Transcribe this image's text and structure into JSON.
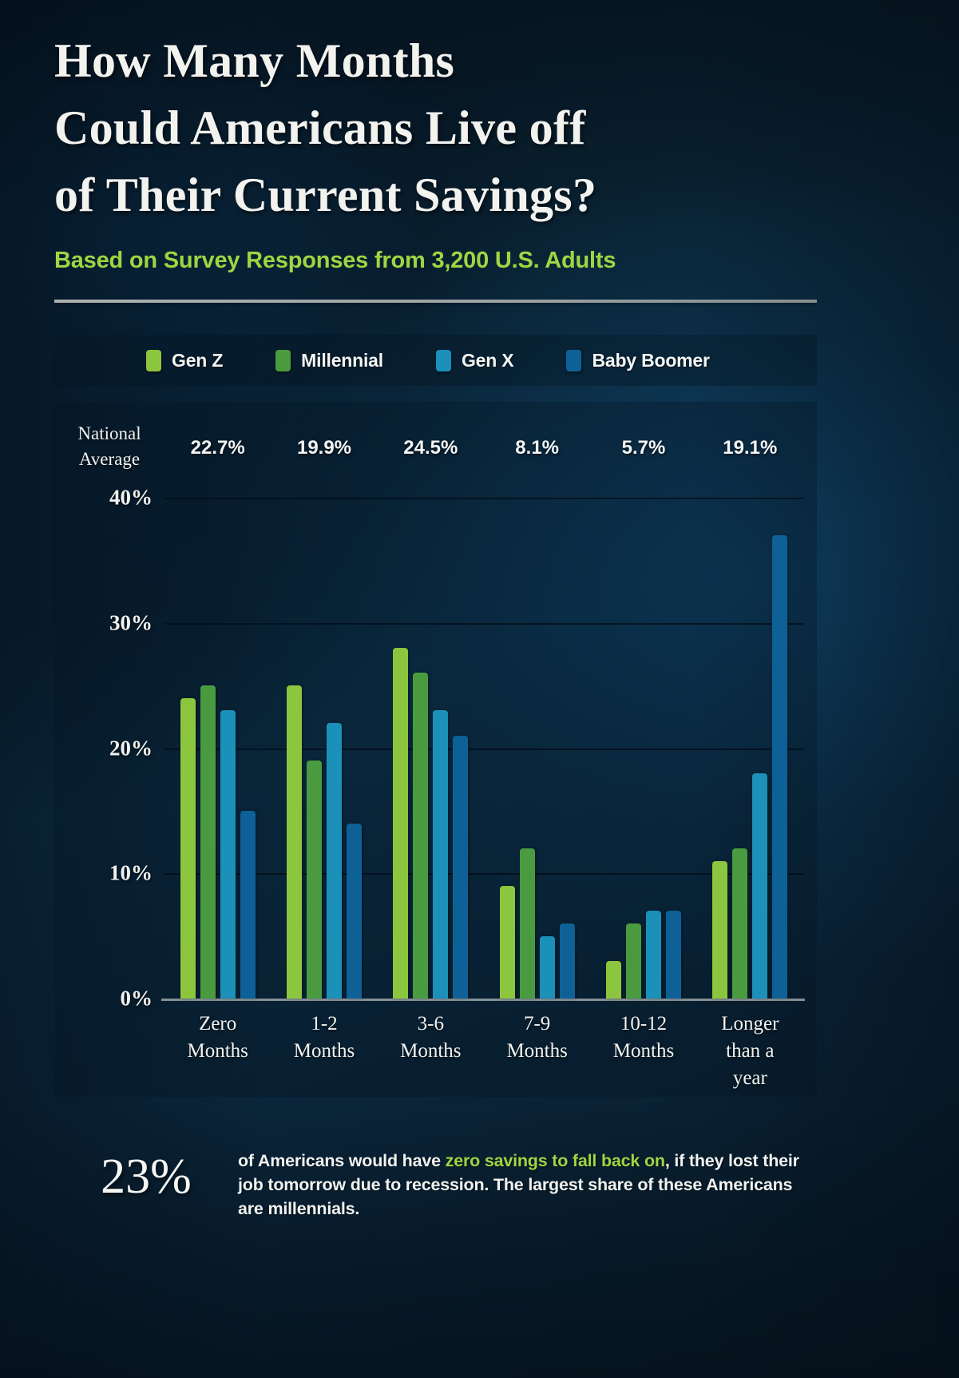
{
  "header": {
    "title_lines": [
      "How Many Months",
      "Could Americans Live off",
      "of Their Current Savings?"
    ],
    "subtitle": "Based on Survey Responses from 3,200 U.S. Adults"
  },
  "colors": {
    "gen_z": "#8cc63e",
    "millennial": "#4a9b40",
    "gen_x": "#1b90b8",
    "baby_boomer": "#0d6196",
    "accent_green": "#9ed642",
    "text_light": "#f2f2ee",
    "panel": "rgba(6,22,36,0.36)"
  },
  "legend": {
    "items": [
      {
        "label": "Gen Z",
        "color": "#8cc63e"
      },
      {
        "label": "Millennial",
        "color": "#4a9b40"
      },
      {
        "label": "Gen X",
        "color": "#1b90b8"
      },
      {
        "label": "Baby Boomer",
        "color": "#0d6196"
      }
    ]
  },
  "national_average": {
    "label_line1": "National",
    "label_line2": "Average",
    "values": [
      "22.7%",
      "19.9%",
      "24.5%",
      "8.1%",
      "5.7%",
      "19.1%"
    ]
  },
  "footer": {
    "stat": "23%",
    "text_part1": "of Americans would have ",
    "highlight": "zero savings to fall back on",
    "text_part2": ", if they lost their job tomorrow due to recession. The largest share of these Americans are millennials."
  },
  "chart_data": {
    "type": "bar",
    "title": "How Many Months Could Americans Live off of Their Current Savings?",
    "subtitle": "Based on Survey Responses from 3,200 U.S. Adults",
    "xlabel": "",
    "ylabel": "",
    "ylim": [
      0,
      40
    ],
    "yticks": [
      0,
      10,
      20,
      30,
      40
    ],
    "ytick_labels": [
      "0%",
      "10%",
      "20%",
      "30%",
      "40%"
    ],
    "grid": true,
    "legend_position": "top",
    "categories": [
      "Zero Months",
      "1-2 Months",
      "3-6 Months",
      "7-9 Months",
      "10-12 Months",
      "Longer than a year"
    ],
    "category_lines": [
      [
        "Zero",
        "Months"
      ],
      [
        "1-2",
        "Months"
      ],
      [
        "3-6",
        "Months"
      ],
      [
        "7-9",
        "Months"
      ],
      [
        "10-12",
        "Months"
      ],
      [
        "Longer",
        "than a",
        "year"
      ]
    ],
    "series": [
      {
        "name": "Gen Z",
        "color": "#8cc63e",
        "values": [
          24,
          25,
          28,
          9,
          3,
          11
        ]
      },
      {
        "name": "Millennial",
        "color": "#4a9b40",
        "values": [
          25,
          19,
          26,
          12,
          6,
          12
        ]
      },
      {
        "name": "Gen X",
        "color": "#1b90b8",
        "values": [
          23,
          22,
          23,
          5,
          7,
          18
        ]
      },
      {
        "name": "Baby Boomer",
        "color": "#0d6196",
        "values": [
          15,
          14,
          21,
          6,
          7,
          37
        ]
      }
    ],
    "national_average_values": [
      22.7,
      19.9,
      24.5,
      8.1,
      5.7,
      19.1
    ],
    "national_average_labels": [
      "22.7%",
      "19.9%",
      "24.5%",
      "8.1%",
      "5.7%",
      "19.1%"
    ]
  }
}
